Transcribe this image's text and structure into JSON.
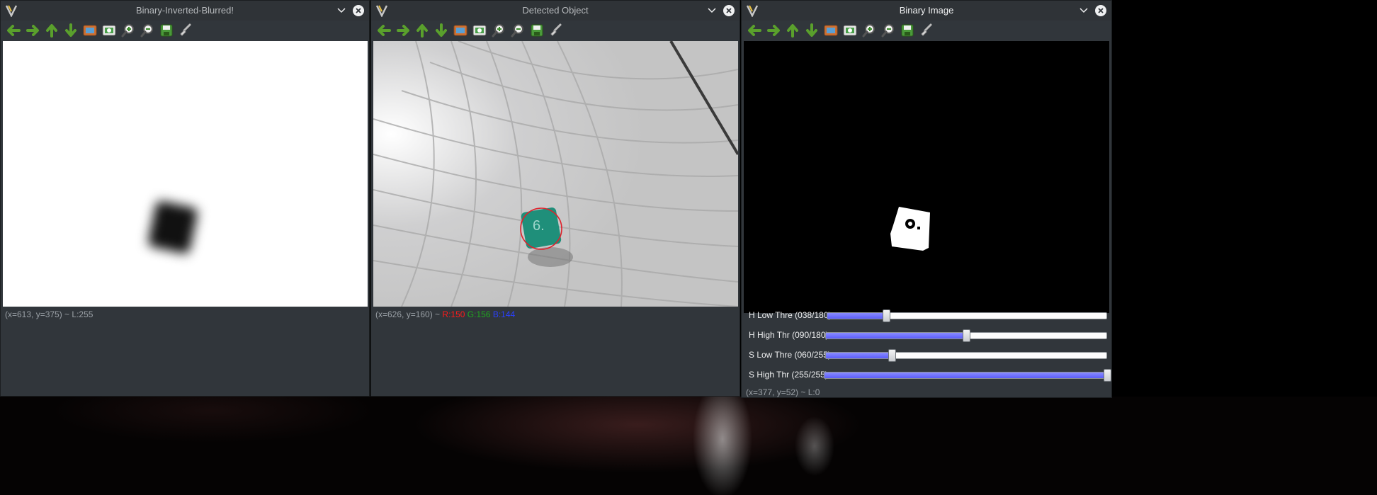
{
  "windows": [
    {
      "title": "Binary-Inverted-Blurred!",
      "status": "(x=613, y=375) ~ L:255"
    },
    {
      "title": "Detected Object",
      "status_prefix": "(x=626, y=160) ~ ",
      "status_r": "R:150",
      "status_g": "G:156",
      "status_b": "B:144"
    },
    {
      "title": "Binary Image",
      "status": "(x=377, y=52) ~ L:0",
      "sliders": [
        {
          "label": "H Low Thre (038/180)",
          "value": 38,
          "max": 180
        },
        {
          "label": "H High Thr (090/180)",
          "value": 90,
          "max": 180
        },
        {
          "label": "S Low Thre (060/255)",
          "value": 60,
          "max": 255
        },
        {
          "label": "S High Thr (255/255)",
          "value": 255,
          "max": 255
        }
      ]
    }
  ],
  "toolbar_icons": [
    "arrow-left-icon",
    "arrow-right-icon",
    "arrow-up-icon",
    "arrow-down-icon",
    "zoom-fit-icon",
    "zoom-original-icon",
    "zoom-in-icon",
    "zoom-out-icon",
    "save-icon",
    "properties-icon"
  ],
  "die_label": "6.",
  "colors": {
    "arrow_green": "#5aa02c",
    "slider_fill": "#6d6ffb",
    "detect_circle": "#e0202a"
  }
}
